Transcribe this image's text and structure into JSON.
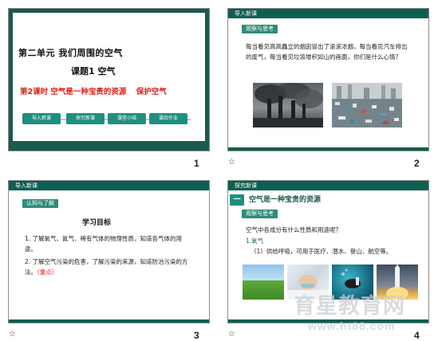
{
  "slides": [
    {
      "number": "1"
    },
    {
      "number": "2"
    },
    {
      "number": "3"
    },
    {
      "number": "4"
    }
  ],
  "corner_mark": "☆",
  "slide1": {
    "unit_title": "第二单元  我们周围的空气",
    "lesson_title": "课题1  空气",
    "subtitle_part1": "第2课时  空气是一种宝贵的资源",
    "subtitle_part2": "保护空气",
    "steps": [
      "导入新课",
      "探究新课",
      "课堂小结",
      "课后作业"
    ],
    "colors": {
      "teal": "#1f8f80",
      "dark": "#1a5a50",
      "red": "#e0201a"
    }
  },
  "slide2": {
    "header": "导入新课",
    "tag": "观察与思考",
    "paragraph": "每当看见高高矗立的烟囱冒出了滚滚浓烟，每当看见汽车排出的废气，每当看见垃圾堆积如山的画面，你们是什么心情？"
  },
  "slide3": {
    "header": "导入新课",
    "tag": "认知与了解",
    "goals_title": "学习目标",
    "goal1": "1. 了解氧气、氮气、稀有气体的物理性质，知道各气体的用途。",
    "goal2": "2. 了解空气污染的危害，了解污染的来源，知道防治污染的方法。",
    "goal2_mark": "（重点）"
  },
  "slide4": {
    "header": "探究新课",
    "section_num": "一",
    "section_title": "空气是一种宝贵的资源",
    "tag": "观察与思考",
    "question": "空气中各成分有什么性质和用途呢？",
    "item": "1.氧气",
    "sub_item": "（1）供给呼吸，可用于医疗、潜水、登山、航空等。"
  },
  "watermark": {
    "cn": "育星教育网",
    "url": "www.ht88.com"
  }
}
